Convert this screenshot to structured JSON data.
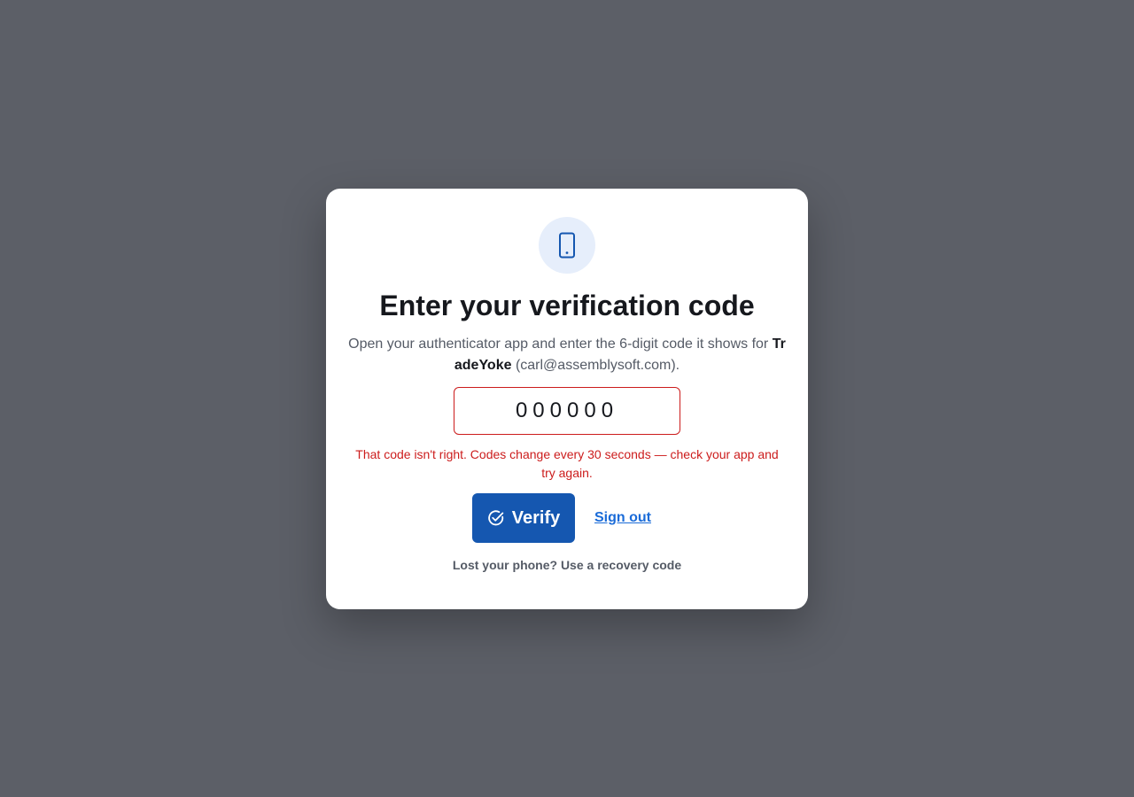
{
  "header": {
    "icon": "smartphone-icon",
    "title": "Enter your verification code"
  },
  "description": {
    "prefix": "Open your authenticator app and enter the 6-digit code it shows for ",
    "app_name": "TradeYoke",
    "suffix": " (carl@assemblysoft.com)."
  },
  "code_field": {
    "value": "000000",
    "state": "error"
  },
  "error_message": "That code isn't right. Codes change every 30 seconds — check your app and try again.",
  "actions": {
    "verify_label": "Verify",
    "verify_icon": "check-circle-icon",
    "sign_out_label": "Sign out",
    "recovery_label": "Lost your phone? Use a recovery code"
  },
  "colors": {
    "backdrop": "#5c5f67",
    "primary": "#1557b0",
    "link": "#1a6bd8",
    "error": "#cc1c1c",
    "icon_bg": "#e6eefb"
  }
}
